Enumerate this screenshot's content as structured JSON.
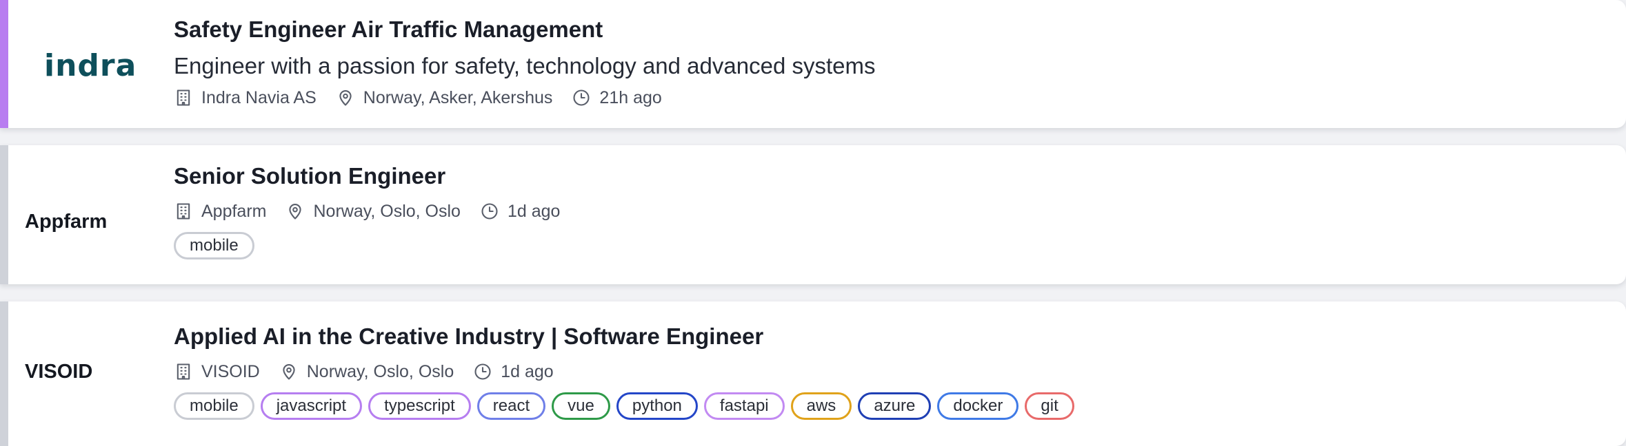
{
  "jobs": [
    {
      "logo_text": "indra",
      "title": "Safety Engineer Air Traffic Management",
      "subtitle": "Engineer with a passion for safety, technology and advanced systems",
      "company": "Indra Navia AS",
      "location": "Norway, Asker, Akershus",
      "posted": "21h ago",
      "accent_color": "#b87df0",
      "tags": []
    },
    {
      "logo_text": "Appfarm",
      "title": "Senior Solution Engineer",
      "company": "Appfarm",
      "location": "Norway, Oslo, Oslo",
      "posted": "1d ago",
      "accent_color": "#cfd2d9",
      "tags": [
        {
          "label": "mobile",
          "color": "#c9ccd3"
        }
      ]
    },
    {
      "logo_text": "VISOID",
      "title": "Applied AI in the Creative Industry | Software Engineer",
      "company": "VISOID",
      "location": "Norway, Oslo, Oslo",
      "posted": "1d ago",
      "accent_color": "#cfd2d9",
      "tags": [
        {
          "label": "mobile",
          "color": "#c9ccd3"
        },
        {
          "label": "javascript",
          "color": "#b67ef0"
        },
        {
          "label": "typescript",
          "color": "#b67ef0"
        },
        {
          "label": "react",
          "color": "#6f7fe8"
        },
        {
          "label": "vue",
          "color": "#2e9a48"
        },
        {
          "label": "python",
          "color": "#2446c8"
        },
        {
          "label": "fastapi",
          "color": "#c28af2"
        },
        {
          "label": "aws",
          "color": "#e0a21a"
        },
        {
          "label": "azure",
          "color": "#1f3fb4"
        },
        {
          "label": "docker",
          "color": "#3f7ae6"
        },
        {
          "label": "git",
          "color": "#e86a6a"
        }
      ]
    }
  ],
  "icons": {
    "company": "building-icon",
    "location": "map-pin-icon",
    "posted": "clock-icon"
  }
}
